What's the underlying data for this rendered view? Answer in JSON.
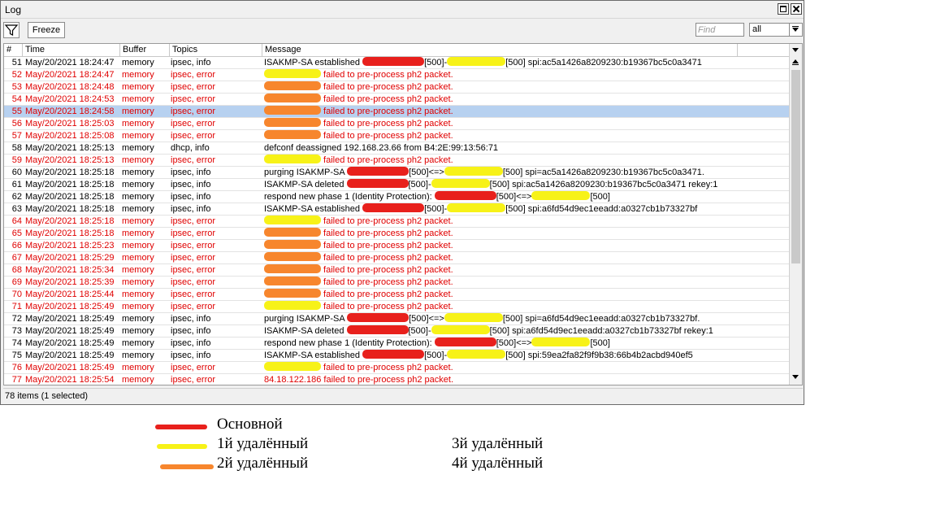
{
  "window": {
    "title": "Log"
  },
  "toolbar": {
    "freeze_label": "Freeze",
    "find_placeholder": "Find",
    "filter_value": "all"
  },
  "columns": [
    "#",
    "Time",
    "Buffer",
    "Topics",
    "Message"
  ],
  "rows": [
    {
      "n": "51",
      "time": "May/20/2021 18:24:47",
      "buffer": "memory",
      "topics": "ipsec, info",
      "msg": "ISAKMP-SA established ",
      "tail": "[500]-",
      "tail2": "[500] spi:ac5a1426a8209230:b19367bc5c0a3471",
      "level": "info"
    },
    {
      "n": "52",
      "time": "May/20/2021 18:24:47",
      "buffer": "memory",
      "topics": "ipsec, error",
      "msg": "",
      "tail": " failed to pre-process ph2 packet.",
      "level": "err"
    },
    {
      "n": "53",
      "time": "May/20/2021 18:24:48",
      "buffer": "memory",
      "topics": "ipsec, error",
      "msg": "",
      "tail": " failed to pre-process ph2 packet.",
      "level": "err"
    },
    {
      "n": "54",
      "time": "May/20/2021 18:24:53",
      "buffer": "memory",
      "topics": "ipsec, error",
      "msg": "",
      "tail": " failed to pre-process ph2 packet.",
      "level": "err"
    },
    {
      "n": "55",
      "time": "May/20/2021 18:24:58",
      "buffer": "memory",
      "topics": "ipsec, error",
      "msg": "",
      "tail": " failed to pre-process ph2 packet.",
      "level": "err"
    },
    {
      "n": "56",
      "time": "May/20/2021 18:25:03",
      "buffer": "memory",
      "topics": "ipsec, error",
      "msg": "",
      "tail": " failed to pre-process ph2 packet.",
      "level": "err"
    },
    {
      "n": "57",
      "time": "May/20/2021 18:25:08",
      "buffer": "memory",
      "topics": "ipsec, error",
      "msg": "",
      "tail": " failed to pre-process ph2 packet.",
      "level": "err"
    },
    {
      "n": "58",
      "time": "May/20/2021 18:25:13",
      "buffer": "memory",
      "topics": "dhcp, info",
      "msg": "defconf deassigned 192.168.23.66 from B4:2E:99:13:56:71",
      "tail": "",
      "level": "info"
    },
    {
      "n": "59",
      "time": "May/20/2021 18:25:13",
      "buffer": "memory",
      "topics": "ipsec, error",
      "msg": "",
      "tail": " failed to pre-process ph2 packet.",
      "level": "err"
    },
    {
      "n": "60",
      "time": "May/20/2021 18:25:18",
      "buffer": "memory",
      "topics": "ipsec, info",
      "msg": "purging ISAKMP-SA ",
      "tail": "[500]<=>",
      "tail2": "[500] spi=ac5a1426a8209230:b19367bc5c0a3471.",
      "level": "info"
    },
    {
      "n": "61",
      "time": "May/20/2021 18:25:18",
      "buffer": "memory",
      "topics": "ipsec, info",
      "msg": "ISAKMP-SA deleted ",
      "tail": "[500]-",
      "tail2": "[500] spi:ac5a1426a8209230:b19367bc5c0a3471 rekey:1",
      "level": "info"
    },
    {
      "n": "62",
      "time": "May/20/2021 18:25:18",
      "buffer": "memory",
      "topics": "ipsec, info",
      "msg": "respond new phase 1 (Identity Protection): ",
      "tail": "[500]<=>",
      "tail2": "[500]",
      "level": "info"
    },
    {
      "n": "63",
      "time": "May/20/2021 18:25:18",
      "buffer": "memory",
      "topics": "ipsec, info",
      "msg": "ISAKMP-SA established ",
      "tail": "[500]-",
      "tail2": "[500] spi:a6fd54d9ec1eeadd:a0327cb1b73327bf",
      "level": "info"
    },
    {
      "n": "64",
      "time": "May/20/2021 18:25:18",
      "buffer": "memory",
      "topics": "ipsec, error",
      "msg": "",
      "tail": " failed to pre-process ph2 packet.",
      "level": "err"
    },
    {
      "n": "65",
      "time": "May/20/2021 18:25:18",
      "buffer": "memory",
      "topics": "ipsec, error",
      "msg": "",
      "tail": " failed to pre-process ph2 packet.",
      "level": "err"
    },
    {
      "n": "66",
      "time": "May/20/2021 18:25:23",
      "buffer": "memory",
      "topics": "ipsec, error",
      "msg": "",
      "tail": " failed to pre-process ph2 packet.",
      "level": "err"
    },
    {
      "n": "67",
      "time": "May/20/2021 18:25:29",
      "buffer": "memory",
      "topics": "ipsec, error",
      "msg": "",
      "tail": " failed to pre-process ph2 packet.",
      "level": "err"
    },
    {
      "n": "68",
      "time": "May/20/2021 18:25:34",
      "buffer": "memory",
      "topics": "ipsec, error",
      "msg": "",
      "tail": " failed to pre-process ph2 packet.",
      "level": "err"
    },
    {
      "n": "69",
      "time": "May/20/2021 18:25:39",
      "buffer": "memory",
      "topics": "ipsec, error",
      "msg": "",
      "tail": " failed to pre-process ph2 packet.",
      "level": "err"
    },
    {
      "n": "70",
      "time": "May/20/2021 18:25:44",
      "buffer": "memory",
      "topics": "ipsec, error",
      "msg": "",
      "tail": " failed to pre-process ph2 packet.",
      "level": "err"
    },
    {
      "n": "71",
      "time": "May/20/2021 18:25:49",
      "buffer": "memory",
      "topics": "ipsec, error",
      "msg": "",
      "tail": " failed to pre-process ph2 packet.",
      "level": "err"
    },
    {
      "n": "72",
      "time": "May/20/2021 18:25:49",
      "buffer": "memory",
      "topics": "ipsec, info",
      "msg": "purging ISAKMP-SA ",
      "tail": "[500]<=>",
      "tail2": "[500] spi=a6fd54d9ec1eeadd:a0327cb1b73327bf.",
      "level": "info"
    },
    {
      "n": "73",
      "time": "May/20/2021 18:25:49",
      "buffer": "memory",
      "topics": "ipsec, info",
      "msg": "ISAKMP-SA deleted ",
      "tail": "[500]-",
      "tail2": "[500] spi:a6fd54d9ec1eeadd:a0327cb1b73327bf rekey:1",
      "level": "info"
    },
    {
      "n": "74",
      "time": "May/20/2021 18:25:49",
      "buffer": "memory",
      "topics": "ipsec, info",
      "msg": "respond new phase 1 (Identity Protection): ",
      "tail": "[500]<=>",
      "tail2": "[500]",
      "level": "info"
    },
    {
      "n": "75",
      "time": "May/20/2021 18:25:49",
      "buffer": "memory",
      "topics": "ipsec, info",
      "msg": "ISAKMP-SA established ",
      "tail": "[500]-",
      "tail2": "[500] spi:59ea2fa82f9f9b38:66b4b2acbd940ef5",
      "level": "info"
    },
    {
      "n": "76",
      "time": "May/20/2021 18:25:49",
      "buffer": "memory",
      "topics": "ipsec, error",
      "msg": "",
      "tail": " failed to pre-process ph2 packet.",
      "level": "err"
    },
    {
      "n": "77",
      "time": "May/20/2021 18:25:54",
      "buffer": "memory",
      "topics": "ipsec, error",
      "msg": "84.18.122.186",
      "tail": " failed to pre-process ph2 packet.",
      "level": "err"
    }
  ],
  "selected_row": "55",
  "status": {
    "text": "78 items (1 selected)"
  },
  "legend": {
    "main": "Основной",
    "remote1": "1й удалённый",
    "remote2": "2й удалённый",
    "remote3": "3й удалённый",
    "remote4": "4й удалённый"
  },
  "colors": {
    "error_text": "#e00000",
    "selected_row": "#b7d1f0",
    "marker_main": "#e8201c",
    "marker_remote1": "#f7f218",
    "marker_remote2": "#f7862d"
  }
}
